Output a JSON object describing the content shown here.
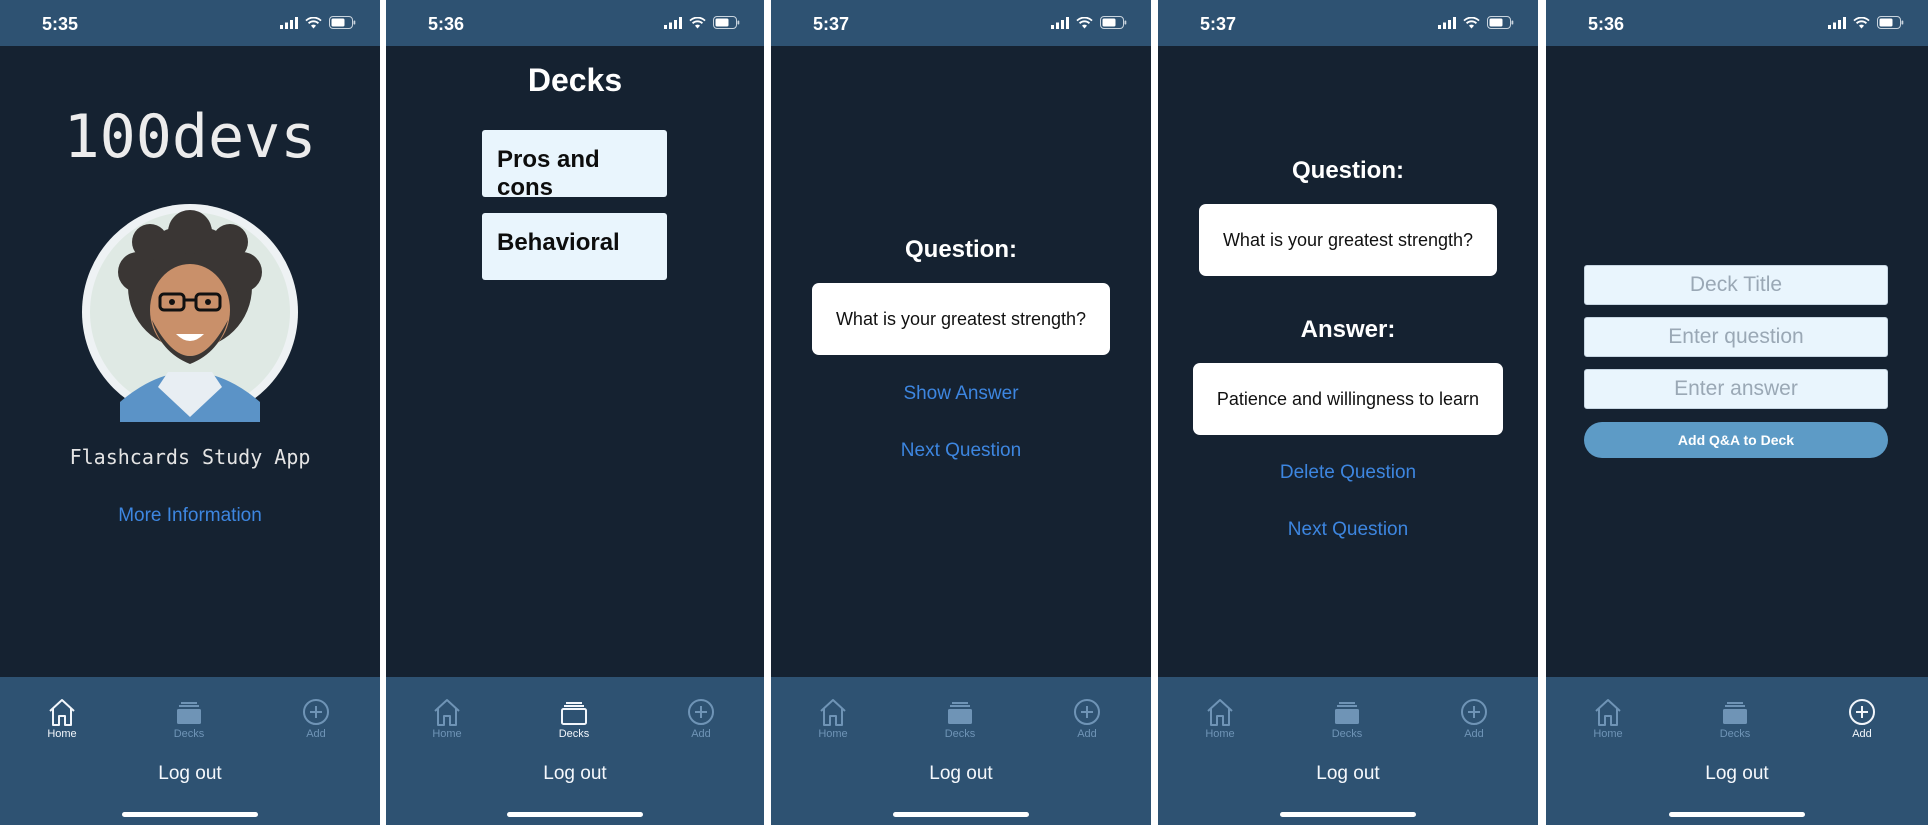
{
  "common": {
    "tabs": {
      "home": "Home",
      "decks": "Decks",
      "add": "Add"
    },
    "logout": "Log out",
    "icon_color": "#6f94b6",
    "icon_active_color": "#f2f6fb"
  },
  "screens": {
    "home": {
      "time": "5:35",
      "title": "100devs",
      "subtitle": "Flashcards Study App",
      "more_info": "More Information"
    },
    "decks": {
      "time": "5:36",
      "title": "Decks",
      "items": [
        {
          "label": "Pros and cons"
        },
        {
          "label": "Behavioral"
        }
      ]
    },
    "question": {
      "time": "5:37",
      "question_label": "Question:",
      "question_text": "What is your greatest strength?",
      "show_answer": "Show Answer",
      "next_question": "Next Question"
    },
    "answer": {
      "time": "5:37",
      "question_label": "Question:",
      "question_text": "What is your greatest strength?",
      "answer_label": "Answer:",
      "answer_text": "Patience and willingness to learn",
      "delete_question": "Delete Question",
      "next_question": "Next Question"
    },
    "add": {
      "time": "5:36",
      "deck_title_placeholder": "Deck Title",
      "question_placeholder": "Enter question",
      "answer_placeholder": "Enter answer",
      "submit_label": "Add Q&A to Deck"
    }
  }
}
